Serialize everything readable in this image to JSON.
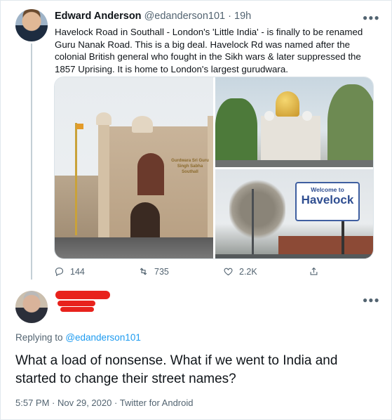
{
  "parent_tweet": {
    "author_name": "Edward Anderson",
    "handle": "@edanderson101",
    "separator": "·",
    "age": "19h",
    "text": "Havelock Road in Southall - London's 'Little India' - is finally to be renamed Guru Nanak Road. This is a big deal. Havelock Rd was named after the colonial British general who fought in the Sikh wars & later suppressed the 1857 Uprising. It is home to London's largest gurudwara.",
    "media": {
      "building_sign": "Gurdwara Sri Guru Singh Sabha Southall",
      "street_sign_top": "Welcome to",
      "street_sign_main": "Havelock"
    },
    "stats": {
      "replies": "144",
      "retweets": "735",
      "likes": "2.2K"
    },
    "icons": {
      "reply": "reply-icon",
      "retweet": "retweet-icon",
      "like": "heart-icon",
      "share": "share-icon",
      "more": "more-icon"
    }
  },
  "reply_tweet": {
    "replying_prefix": "Replying to",
    "replying_handle": "@edanderson101",
    "text": "What a load of nonsense. What if we went to India and started to change their street names?",
    "time": "5:57 PM",
    "date": "Nov 29, 2020",
    "client": "Twitter for Android",
    "separator": "·",
    "redaction_color": "#e8221c"
  },
  "colors": {
    "link": "#1d9bf0",
    "muted": "#536471",
    "text": "#0f1419"
  }
}
